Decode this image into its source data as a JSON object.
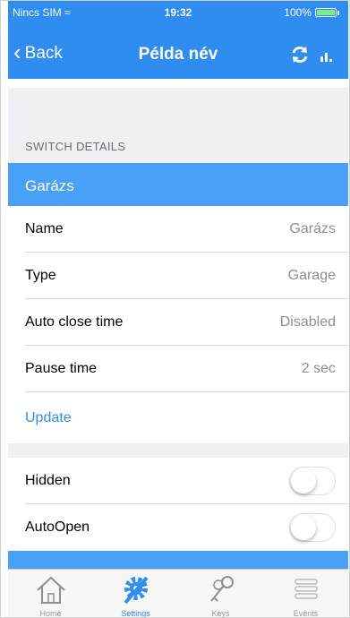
{
  "status_bar": {
    "carrier": "Nincs SIM",
    "time": "19:32",
    "battery": "100%"
  },
  "nav": {
    "back_label": "Back",
    "title": "Példa név",
    "icons": [
      "refresh-icon",
      "signal-icon"
    ]
  },
  "section": {
    "header": "SWITCH DETAILS",
    "group_title": "Garázs"
  },
  "details": [
    {
      "label": "Name",
      "value": "Garázs"
    },
    {
      "label": "Type",
      "value": "Garage"
    },
    {
      "label": "Auto close time",
      "value": "Disabled"
    },
    {
      "label": "Pause time",
      "value": "2 sec"
    }
  ],
  "update_label": "Update",
  "toggles": [
    {
      "label": "Hidden",
      "on": false
    },
    {
      "label": "AutoOpen",
      "on": false
    }
  ],
  "tabs": [
    {
      "label": "Home",
      "icon": "home-icon",
      "active": false
    },
    {
      "label": "Settings",
      "icon": "settings-gear-icon",
      "active": true
    },
    {
      "label": "Keys",
      "icon": "keys-icon",
      "active": false
    },
    {
      "label": "Events",
      "icon": "events-list-icon",
      "active": false
    }
  ],
  "colors": {
    "accent": "#2f8cf0",
    "group_bar": "#48a0f7",
    "background": "#efeff4"
  }
}
